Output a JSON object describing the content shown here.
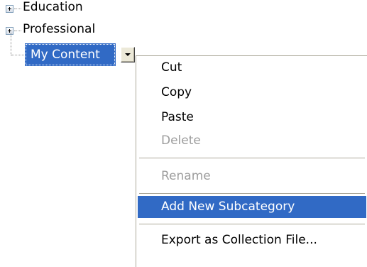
{
  "tree": {
    "items": [
      {
        "label": "Education",
        "expander": "plus-icon"
      },
      {
        "label": "Professional",
        "expander": "plus-icon"
      }
    ],
    "selected": {
      "label": "My Content",
      "dropdown_icon": "chevron-down-icon"
    }
  },
  "context_menu": {
    "items": [
      {
        "label": "Cut",
        "state": "enabled"
      },
      {
        "label": "Copy",
        "state": "enabled"
      },
      {
        "label": "Paste",
        "state": "enabled"
      },
      {
        "label": "Delete",
        "state": "disabled"
      },
      {
        "label": "Rename",
        "state": "disabled"
      },
      {
        "label": "Add New Subcategory",
        "state": "highlighted"
      },
      {
        "label": "Export as Collection File...",
        "state": "enabled"
      }
    ]
  },
  "colors": {
    "selection": "#316ac5",
    "disabled_text": "#9d9d9d",
    "separator": "#aca899"
  }
}
